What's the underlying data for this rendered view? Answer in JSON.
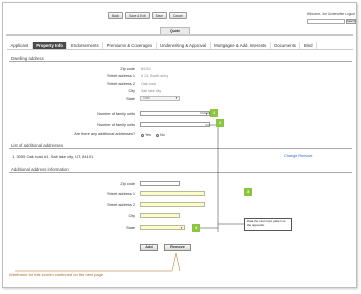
{
  "topnav": {
    "buttons": [
      "Back",
      "Save & Exit",
      "Save",
      "Cancel"
    ]
  },
  "header": {
    "welcome": "Welcome, Joe Underwriter Logout",
    "search_button": "Search"
  },
  "quote_tab": "Quote",
  "tabs": [
    "Applicant",
    "Property Info",
    "Endorsements",
    "Premiums & Coverages",
    "Underwriting & Approval",
    "Mortgagee & Add. Interests",
    "Documents",
    "Bind"
  ],
  "active_tab": "Property Info",
  "dwelling": {
    "section_title": "Dwelling address",
    "zip_label": "Zip code",
    "zip_value": "84101",
    "street1_label": "Street address 1",
    "street1_value": "# 13, South story",
    "street2_label": "Street address 2",
    "street2_value": "Oak road",
    "city_label": "City",
    "city_value": "Salt lake city",
    "state_label": "State",
    "state_value": "Utah"
  },
  "family": {
    "units_select_label": "Number of family units",
    "units_input_label": "Number of family units",
    "additional_q": "Are there any additional addresses?",
    "yes": "Yes",
    "no": "No"
  },
  "list": {
    "section_title": "List of additional addresses",
    "row": "1. 3055 Oak road #1, Salt lake city, UT, 84101",
    "change": "Change",
    "remove": "Remove"
  },
  "additional": {
    "section_title": "Additional address information",
    "zip_label": "Zip code",
    "street1_label": "Street address 1",
    "street2_label": "Street address 2",
    "city_label": "City",
    "state_label": "State"
  },
  "callouts": [
    "1",
    "2",
    "3",
    "4"
  ],
  "note": "Data the next input pattern is the appendix.",
  "buttons": {
    "add": "Add",
    "remove": "Remove"
  },
  "bottom_note": "Wireframe for this screen continued on the next page"
}
